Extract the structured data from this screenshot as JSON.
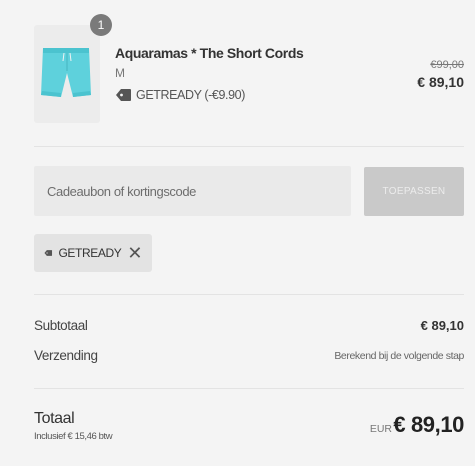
{
  "product": {
    "quantity": "1",
    "title": "Aquaramas * The Short Cords",
    "variant": "M",
    "discount_label": "GETREADY (-€9.90)",
    "original_price": "€99,00",
    "price": "€ 89,10"
  },
  "discount": {
    "placeholder": "Cadeaubon of kortingscode",
    "apply_label": "TOEPASSEN",
    "applied_code": "GETREADY"
  },
  "summary": {
    "subtotal_label": "Subtotaal",
    "subtotal_value": "€ 89,10",
    "shipping_label": "Verzending",
    "shipping_value": "Berekend bij de volgende stap"
  },
  "total": {
    "label": "Totaal",
    "tax_note": "Inclusief € 15,46 btw",
    "currency": "EUR",
    "amount": "€ 89,10"
  },
  "colors": {
    "background": "#f4f4f4",
    "shorts": "#5ed1dc",
    "apply_button": "#c9c9c9"
  },
  "icons": [
    "tag-icon",
    "close-icon"
  ]
}
